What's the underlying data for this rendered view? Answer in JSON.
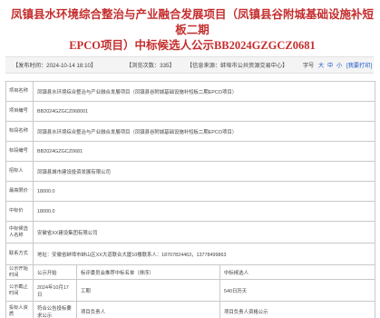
{
  "header": {
    "title_line1": "凤镇县水环境综合整治与产业融合发展项目（凤镇县谷附城基础设施补短板二期",
    "title_line2": "EPCO项目）中标候选人公示BB2024GZGCZ0681"
  },
  "meta": {
    "publish_time": "【发布时间：2024-10-14 18:10】",
    "views": "【浏览次数：335】",
    "source": "【信息来源：蚌埠市公共资源交易中心】",
    "font_label": "字号",
    "font_options": [
      "大",
      "中",
      "小"
    ],
    "print_label": "[我要打印]"
  },
  "table": {
    "rows": [
      {
        "label": "项目名称",
        "value": "凤镇县水环境综合整治与产业融合发展项目（凤镇县谷附城基础设施补短板二期EPCO项目）"
      },
      {
        "label": "项目编号",
        "value": "BB2024GZGCZ068001"
      },
      {
        "label": "标段名称",
        "value": "凤镇县水环境综合整治与产业融合发展项目（凤镇县谷附城基础设施补短板二期EPCO项目）"
      },
      {
        "label": "标段编号",
        "value": "BB2024GZGCZ0681"
      },
      {
        "label": "招标人",
        "value": "凤镇县城市建设投资发展有限公司"
      },
      {
        "label": "最高限价",
        "value": "18000.0"
      },
      {
        "label": "中标价",
        "value": "18000.0"
      },
      {
        "label": "中标候选人名称",
        "value": "安徽省XX建设集团有限公司"
      },
      {
        "label": "联系方式",
        "value": "地址：安徽省蚌埠市蚌山区XX大道联合大厦10楼联系人：18707824463，13778499863"
      }
    ],
    "bottom": [
      {
        "label": "公示开始时间",
        "value": "公示开始",
        "label2": "标评委员会推荐中标名单（排序）",
        "value2": "中标候选人"
      },
      {
        "label": "公示截止时间",
        "value": "2024年10月17日",
        "label2": "工期",
        "value2": "540日历天"
      },
      {
        "label": "投标人资质",
        "value": "符合公告投标要求公示",
        "label2": "项目负责人",
        "value2": "项目负责人资格公示"
      }
    ]
  }
}
